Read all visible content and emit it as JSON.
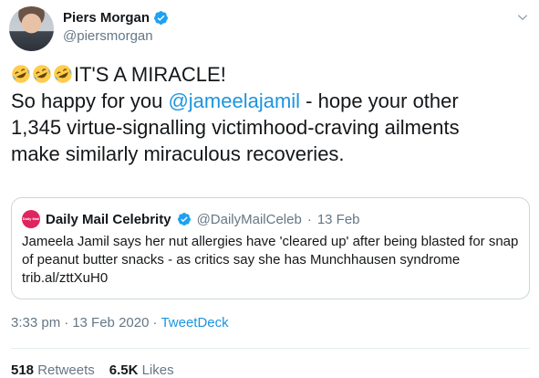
{
  "author": {
    "display_name": "Piers Morgan",
    "handle": "@piersmorgan",
    "verified": true
  },
  "tweet": {
    "emoji_prefix": [
      "rolling-on-floor-laughing",
      "rolling-on-floor-laughing",
      "rolling-on-floor-laughing"
    ],
    "line1": "IT'S A MIRACLE!",
    "line2_before": "So happy for you ",
    "line2_mention": "@jameelajamil",
    "line2_after": " - hope your other",
    "line3": "1,345 virtue-signalling victimhood-craving ailments",
    "line4": "make similarly miraculous recoveries."
  },
  "quoted_tweet": {
    "logo_text": "Daily Mail",
    "display_name": "Daily Mail Celebrity",
    "handle": "@DailyMailCeleb",
    "separator": "·",
    "date": "13 Feb",
    "text": "Jameela Jamil says her nut allergies have 'cleared up' after being blasted for snap of peanut butter snacks - as critics say she has Munchhausen syndrome trib.al/zttXuH0"
  },
  "meta": {
    "time": "3:33 pm",
    "separator1": "·",
    "date": "13 Feb 2020",
    "separator2": "·",
    "source": "TweetDeck"
  },
  "stats": {
    "retweets_count": "518",
    "retweets_label": "Retweets",
    "likes_count": "6.5K",
    "likes_label": "Likes"
  },
  "colors": {
    "accent": "#1b95e0",
    "muted": "#657786",
    "border": "#ccd6dd",
    "brand_red": "#e0245e"
  }
}
